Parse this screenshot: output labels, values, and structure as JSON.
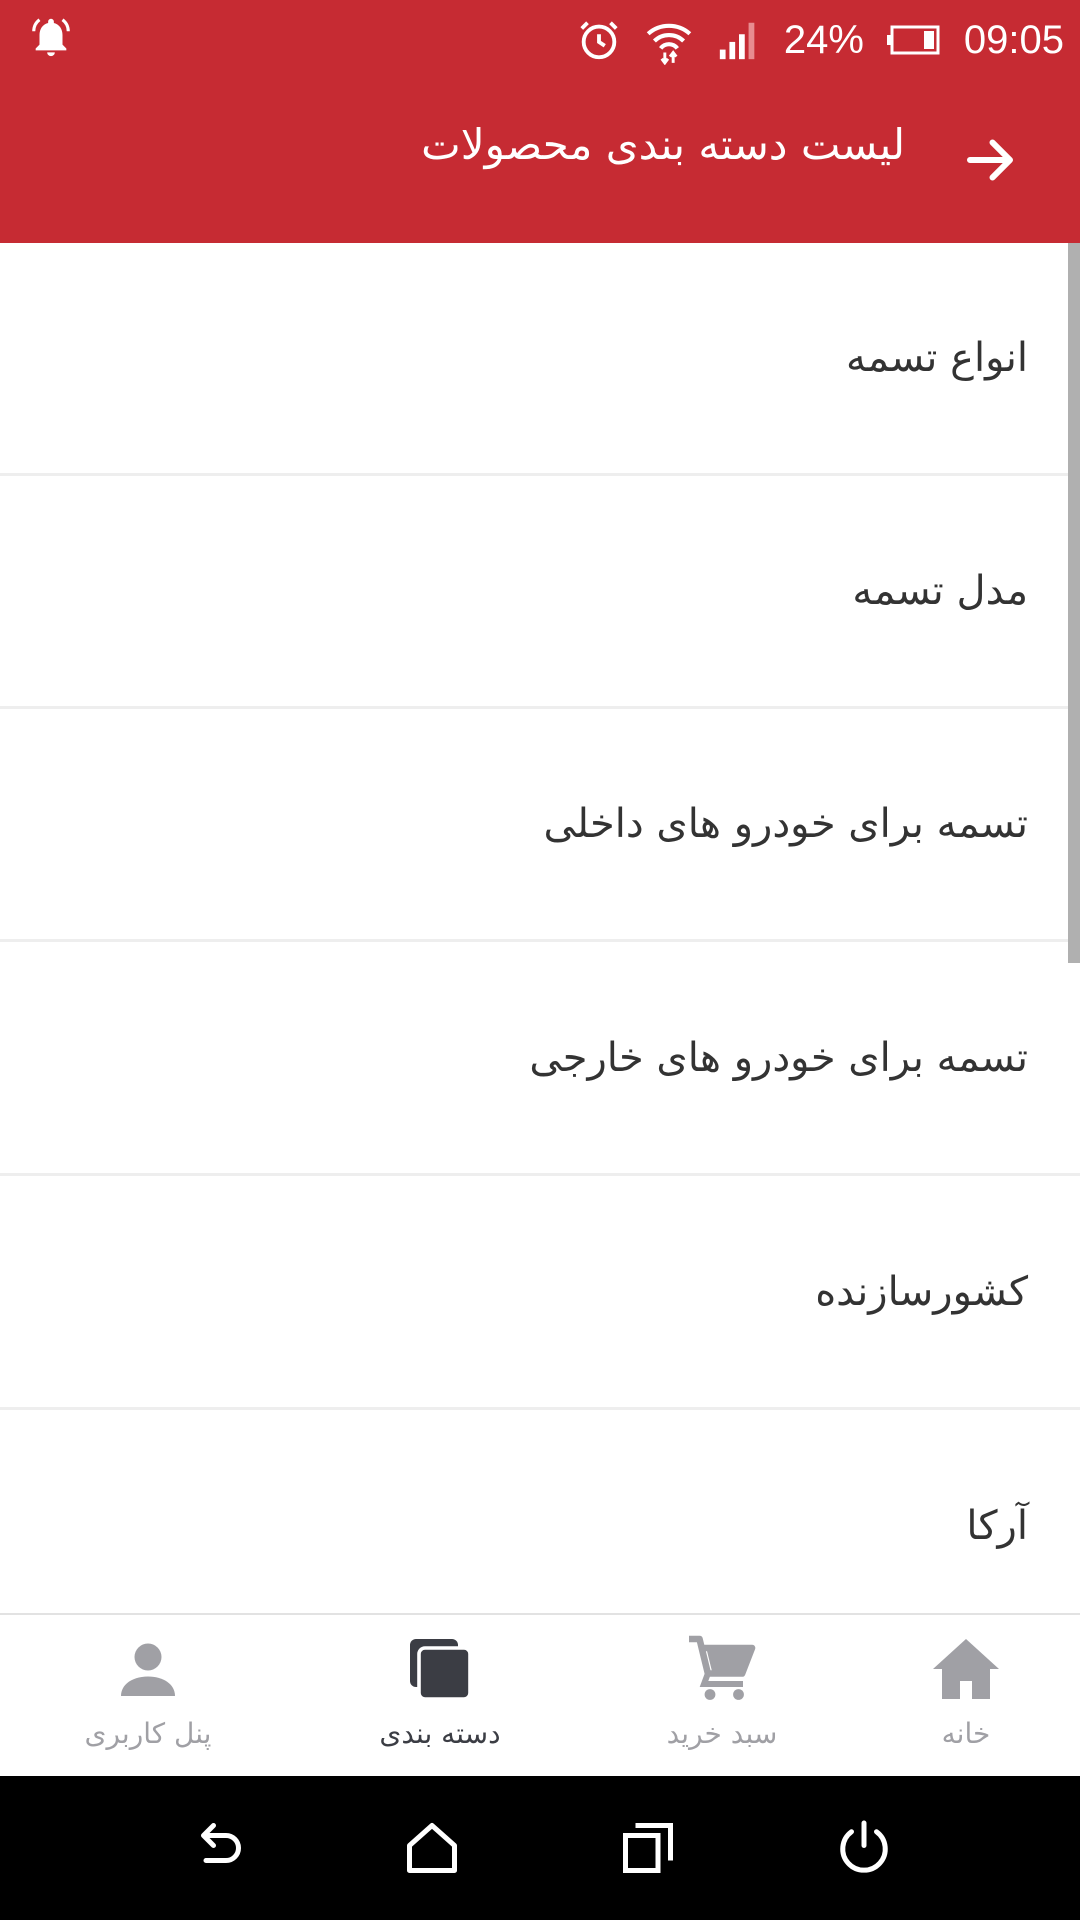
{
  "status_bar": {
    "battery_percent": "24%",
    "time": "09:05",
    "icons": [
      "bell-alert-icon",
      "alarm-clock-icon",
      "wifi-icon",
      "signal-icon",
      "battery-icon"
    ]
  },
  "app_bar": {
    "title": "لیست دسته بندی محصولات",
    "back_icon": "arrow-right-icon"
  },
  "categories": [
    {
      "label": "انواع تسمه"
    },
    {
      "label": "مدل تسمه"
    },
    {
      "label": "تسمه برای خودرو های داخلی"
    },
    {
      "label": "تسمه برای خودرو های خارجی"
    },
    {
      "label": "کشورسازنده"
    },
    {
      "label": "آرکا"
    }
  ],
  "bottom_nav": {
    "items": [
      {
        "label": "پنل کاربری",
        "icon": "user-icon",
        "active": false
      },
      {
        "label": "دسته بندی",
        "icon": "category-icon",
        "active": true
      },
      {
        "label": "سبد خرید",
        "icon": "cart-icon",
        "active": false
      },
      {
        "label": "خانه",
        "icon": "home-icon",
        "active": false
      }
    ]
  },
  "colors": {
    "primary": "#c62b33",
    "nav_inactive": "#a0a0a5",
    "nav_active": "#3b3d44"
  }
}
